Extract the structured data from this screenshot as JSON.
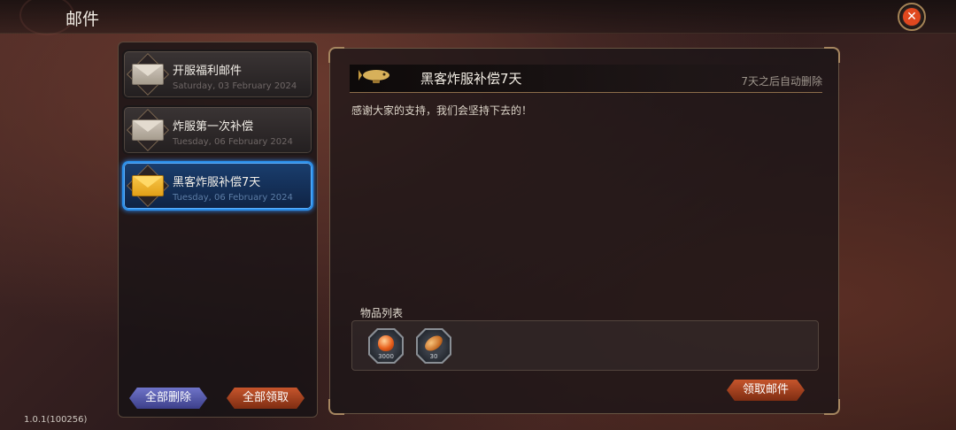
{
  "header": {
    "title": "邮件",
    "close_icon": "close-icon"
  },
  "mail_list": {
    "items": [
      {
        "title": "开服福利邮件",
        "date": "Saturday, 03 February 2024",
        "icon": "envelope-open-icon",
        "active": false
      },
      {
        "title": "炸服第一次补偿",
        "date": "Tuesday, 06 February 2024",
        "icon": "envelope-open-icon",
        "active": false
      },
      {
        "title": "黑客炸服补偿7天",
        "date": "Tuesday, 06 February 2024",
        "icon": "envelope-closed-icon",
        "active": true
      }
    ],
    "delete_all_label": "全部删除",
    "claim_all_label": "全部领取"
  },
  "detail": {
    "title": "黑客炸服补偿7天",
    "expire_text": "7天之后自动删除",
    "body": "感谢大家的支持，我们会坚持下去的！",
    "items_label": "物品列表",
    "items": [
      {
        "icon": "orange-gem-icon",
        "quantity": "3000"
      },
      {
        "icon": "bread-icon",
        "quantity": "30"
      }
    ],
    "claim_label": "领取邮件"
  },
  "version": "1.0.1(100256)",
  "colors": {
    "active_blue": "#2b8ee8",
    "claim_orange": "#c6552c",
    "delete_purple": "#6f74c9",
    "close_red": "#e0481f"
  }
}
